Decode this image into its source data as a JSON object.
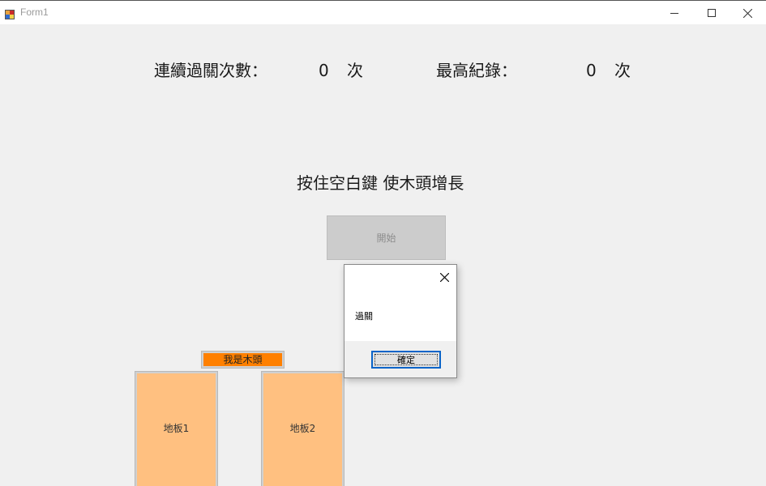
{
  "window": {
    "title": "Form1"
  },
  "stats": {
    "streak_label": "連續過關次數：",
    "streak_value": "0",
    "streak_unit": "次",
    "record_label": "最高紀錄：",
    "record_value": "0",
    "record_unit": "次"
  },
  "instruction": "按住空白鍵 使木頭增長",
  "start_button": {
    "label": "開始"
  },
  "wood": {
    "label": "我是木頭"
  },
  "floors": [
    {
      "label": "地板1"
    },
    {
      "label": "地板2"
    }
  ],
  "dialog": {
    "message": "過關",
    "ok_label": "確定"
  },
  "colors": {
    "wood": "#ff8000",
    "floor": "#ffc080",
    "background": "#f0f0f0",
    "focus_border": "#0a64c8"
  },
  "icons": {
    "app": "winforms-app-icon",
    "minimize": "minimize-icon",
    "maximize": "maximize-icon",
    "close": "close-icon",
    "dialog_close": "close-icon"
  }
}
